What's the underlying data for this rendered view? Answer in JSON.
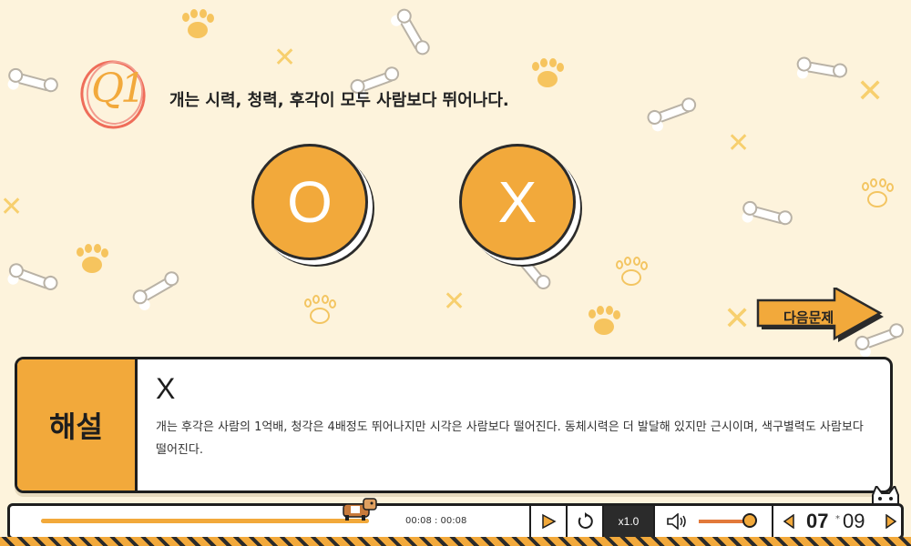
{
  "question": {
    "badge": "Q1",
    "text": "개는 시력, 청력, 후각이 모두 사람보다 뛰어나다."
  },
  "answers": {
    "o_label": "O",
    "x_label": "X"
  },
  "next_button": {
    "label": "다음문제"
  },
  "explanation": {
    "tag": "해설",
    "answer": "X",
    "body": "개는 후각은 사람의 1억배, 청각은 4배정도 뛰어나지만 시각은 사람보다 떨어진다. 동체시력은 더 발달해 있지만 근시이며, 색구별력도 사람보다 떨어진다."
  },
  "player": {
    "time_text": "00:08 : 00:08",
    "progress_fraction": 1.0,
    "speed_label": "x1.0",
    "volume_fraction": 0.8,
    "page_current": "07",
    "page_separator": "*",
    "page_total": "09"
  },
  "colors": {
    "accent": "#f2a93b",
    "background": "#fdf3dc",
    "dark": "#1e1e1e"
  }
}
